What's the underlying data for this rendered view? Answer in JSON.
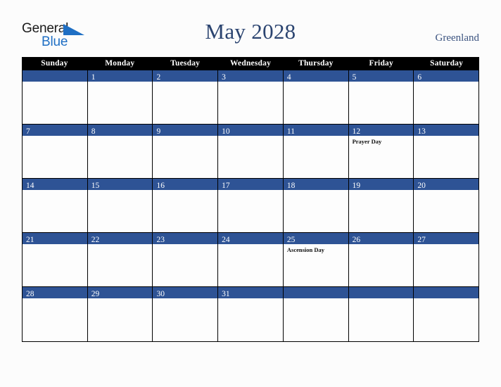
{
  "logo": {
    "word1": "General",
    "word2": "Blue",
    "triangle_color": "#1f6fc4",
    "word1_color": "#1a1a1a",
    "word2_color": "#1f6fc4"
  },
  "header": {
    "title": "May 2028",
    "location": "Greenland",
    "title_color": "#2b4470",
    "location_color": "#3c5480"
  },
  "calendar": {
    "weekday_headers": [
      "Sunday",
      "Monday",
      "Tuesday",
      "Wednesday",
      "Thursday",
      "Friday",
      "Saturday"
    ],
    "header_bg": "#000000",
    "header_text_color": "#ffffff",
    "day_bar_color": "#2e5395",
    "day_number_color": "#ffffff",
    "cell_bg": "#fdfdfd",
    "grid_line_color": "#000000",
    "weeks": [
      [
        {
          "day": "",
          "events": []
        },
        {
          "day": "1",
          "events": []
        },
        {
          "day": "2",
          "events": []
        },
        {
          "day": "3",
          "events": []
        },
        {
          "day": "4",
          "events": []
        },
        {
          "day": "5",
          "events": []
        },
        {
          "day": "6",
          "events": []
        }
      ],
      [
        {
          "day": "7",
          "events": []
        },
        {
          "day": "8",
          "events": []
        },
        {
          "day": "9",
          "events": []
        },
        {
          "day": "10",
          "events": []
        },
        {
          "day": "11",
          "events": []
        },
        {
          "day": "12",
          "events": [
            "Prayer Day"
          ]
        },
        {
          "day": "13",
          "events": []
        }
      ],
      [
        {
          "day": "14",
          "events": []
        },
        {
          "day": "15",
          "events": []
        },
        {
          "day": "16",
          "events": []
        },
        {
          "day": "17",
          "events": []
        },
        {
          "day": "18",
          "events": []
        },
        {
          "day": "19",
          "events": []
        },
        {
          "day": "20",
          "events": []
        }
      ],
      [
        {
          "day": "21",
          "events": []
        },
        {
          "day": "22",
          "events": []
        },
        {
          "day": "23",
          "events": []
        },
        {
          "day": "24",
          "events": []
        },
        {
          "day": "25",
          "events": [
            "Ascension Day"
          ]
        },
        {
          "day": "26",
          "events": []
        },
        {
          "day": "27",
          "events": []
        }
      ],
      [
        {
          "day": "28",
          "events": []
        },
        {
          "day": "29",
          "events": []
        },
        {
          "day": "30",
          "events": []
        },
        {
          "day": "31",
          "events": []
        },
        {
          "day": "",
          "events": []
        },
        {
          "day": "",
          "events": []
        },
        {
          "day": "",
          "events": []
        }
      ]
    ]
  }
}
